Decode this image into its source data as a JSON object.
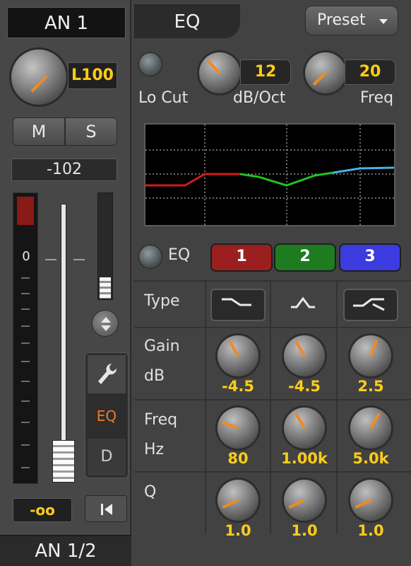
{
  "channel": {
    "name": "AN 1",
    "output": "AN 1/2",
    "pan": "L100",
    "mute_label": "M",
    "solo_label": "S",
    "level_readout": "-102",
    "fader_scale_zero": "0",
    "fader_value": "-oo",
    "tabs": {
      "settings_icon": "wrench-icon",
      "eq": "EQ",
      "dynamics": "D"
    }
  },
  "eq": {
    "title": "EQ",
    "preset_label": "Preset",
    "locut": {
      "label": "Lo Cut",
      "slope": "12",
      "slope_label": "dB/Oct",
      "freq": "20",
      "freq_label": "Freq"
    },
    "enable_label": "EQ",
    "bands": [
      {
        "label": "1",
        "color": "#9b1f1f",
        "gain": "-4.5",
        "freq": "80",
        "q": "1.0"
      },
      {
        "label": "2",
        "color": "#1f7b20",
        "gain": "-4.5",
        "freq": "1.00k",
        "q": "1.0"
      },
      {
        "label": "3",
        "color": "#3b3be0",
        "gain": "2.5",
        "freq": "5.0k",
        "q": "1.0"
      }
    ],
    "rows": {
      "type": "Type",
      "gain": "Gain",
      "gain_unit": "dB",
      "freq": "Freq",
      "freq_unit": "Hz",
      "q": "Q"
    },
    "type_icons": [
      "low-shelf-icon",
      "peak-icon",
      "high-shelf-icon"
    ],
    "curve_colors": {
      "band1": "#d11a1a",
      "band2": "#22c022",
      "band3": "#4ab0ea"
    },
    "accent_color": "#ffcc1a"
  }
}
